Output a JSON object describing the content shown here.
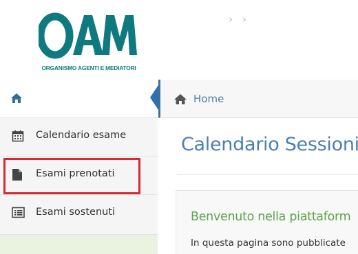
{
  "logo": {
    "mark_text": "OAM",
    "subtitle": "ORGANISMO AGENTI E MEDIATORI",
    "brand_color": "#0e7a80"
  },
  "nav": {
    "home_icon": "home-icon",
    "collapse_icon": "chevron-left-icon"
  },
  "breadcrumb": {
    "home_label": "Home",
    "separator": "›"
  },
  "sidebar": {
    "items": [
      {
        "label": "Calendario esame",
        "icon": "calendar-icon"
      },
      {
        "label": "Esami prenotati",
        "icon": "file-icon",
        "highlighted": true
      },
      {
        "label": "Esami sostenuti",
        "icon": "list-icon"
      }
    ],
    "active_color": "#e9f3e0"
  },
  "main": {
    "title": "Calendario Sessioni",
    "welcome": "Benvenuto nella piattaform",
    "intro": "In questa pagina sono pubblicate"
  },
  "colors": {
    "accent_blue": "#4b7fb4",
    "welcome_green": "#5aa54a",
    "highlight_red": "#d42a35"
  }
}
